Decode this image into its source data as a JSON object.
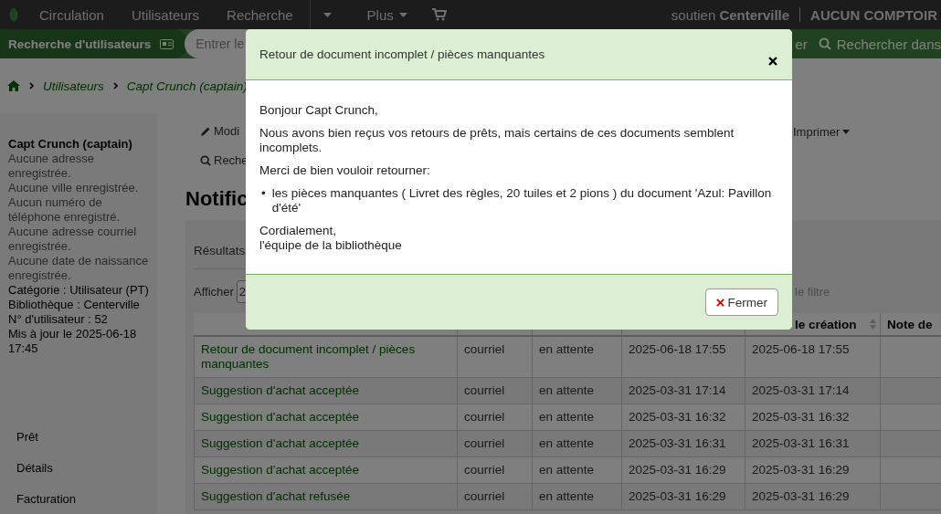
{
  "nav": {
    "items": [
      {
        "kind": "link",
        "label": "Circulation"
      },
      {
        "kind": "link",
        "label": "Utilisateurs"
      },
      {
        "kind": "link",
        "label": "Recherche"
      },
      {
        "kind": "caret"
      },
      {
        "kind": "dropdown",
        "label": "Plus"
      },
      {
        "kind": "cart"
      }
    ],
    "user": {
      "name": "soutien",
      "branch": "Centerville",
      "desk": "AUCUN COMPTOIR"
    }
  },
  "search_bar": {
    "title": "Recherche d'utilisateurs",
    "placeholder": "Entrer le",
    "right_fragment": "er",
    "search_label": "Rechercher dans"
  },
  "breadcrumbs": [
    "Utilisateurs",
    "Capt Crunch (captain)"
  ],
  "patron": {
    "name": "Capt Crunch (captain)",
    "details": [
      {
        "kind": "missing",
        "text": "Aucune adresse enregistrée."
      },
      {
        "kind": "missing",
        "text": "Aucune ville enregistrée."
      },
      {
        "kind": "missing",
        "text": "Aucun numéro de téléphone enregistré."
      },
      {
        "kind": "missing",
        "text": "Aucune adresse courriel enregistrée."
      },
      {
        "kind": "missing",
        "text": "Aucune date de naissance enregistrée."
      },
      {
        "kind": "info",
        "text": "Catégorie : Utilisateur (PT)"
      },
      {
        "kind": "info",
        "text": "Bibliothèque : Centerville"
      },
      {
        "kind": "info",
        "text": "N° d'utilisateur : 52"
      },
      {
        "kind": "info",
        "text": "Mis à jour le 2025-06-18 17:45"
      }
    ]
  },
  "sidebar_menu": [
    "Prêt",
    "Détails",
    "Facturation"
  ],
  "toolbar": {
    "edit_fragment": "Modi",
    "search_fragment": "Reche",
    "print": "Imprimer"
  },
  "heading": "Notific",
  "panel": {
    "results_fragment": "Résultats",
    "show_label": "Afficher",
    "show_value_fragment": "2",
    "filter_fragment": "le filtre"
  },
  "table": {
    "columns": [
      "",
      "",
      "",
      "",
      "le création",
      "Note de"
    ],
    "rows": [
      {
        "cells": [
          "Retour de document incomplet / pièces manquantes",
          "courriel",
          "en attente",
          "2025-06-18 17:55",
          "2025-06-18 17:55",
          ""
        ]
      },
      {
        "cells": [
          "Suggestion d'achat acceptée",
          "courriel",
          "en attente",
          "2025-03-31 17:14",
          "2025-03-31 17:14",
          ""
        ]
      },
      {
        "cells": [
          "Suggestion d'achat acceptée",
          "courriel",
          "en attente",
          "2025-03-31 16:32",
          "2025-03-31 16:32",
          ""
        ]
      },
      {
        "cells": [
          "Suggestion d'achat acceptée",
          "courriel",
          "en attente",
          "2025-03-31 16:31",
          "2025-03-31 16:31",
          ""
        ]
      },
      {
        "cells": [
          "Suggestion d'achat acceptée",
          "courriel",
          "en attente",
          "2025-03-31 16:29",
          "2025-03-31 16:29",
          ""
        ]
      },
      {
        "cells": [
          "Suggestion d'achat refusée",
          "courriel",
          "en attente",
          "2025-03-31 16:29",
          "2025-03-31 16:29",
          ""
        ]
      }
    ]
  },
  "modal": {
    "title": "Retour de document incomplet / pièces manquantes",
    "blocks": [
      {
        "kind": "paragraph",
        "lines": [
          "Bonjour Capt Crunch,"
        ]
      },
      {
        "kind": "paragraph",
        "lines": [
          "Nous avons bien reçus vos retours de prêts, mais certains de ces documents semblent incomplets."
        ]
      },
      {
        "kind": "paragraph",
        "lines": [
          "Merci de bien vouloir retourner:"
        ]
      },
      {
        "kind": "list",
        "bullet": "•",
        "items": [
          "les pièces manquantes ( Livret des règles, 20 tuiles et 2 pions ) du document 'Azul: Pavillon d'été'"
        ]
      },
      {
        "kind": "paragraph",
        "lines": [
          "Cordialement,",
          "l'équipe de la bibliothèque"
        ]
      }
    ],
    "close_button": "Fermer"
  }
}
